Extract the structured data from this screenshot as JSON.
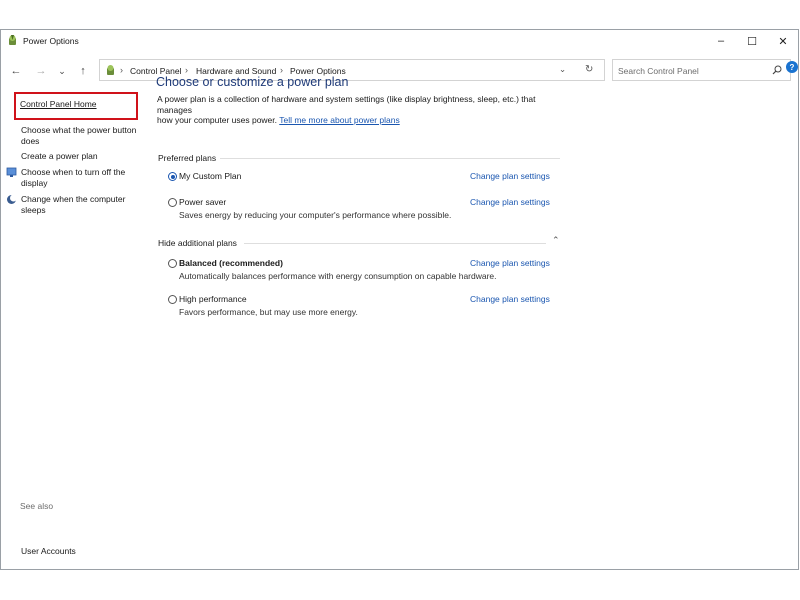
{
  "window": {
    "title": "Power Options",
    "controls": {
      "minimize": "–",
      "maximize": "☐",
      "close": "✕"
    }
  },
  "nav": {
    "back": "←",
    "forward": "→",
    "recent": "⌄",
    "up": "↑"
  },
  "address": {
    "crumbs": [
      "Control Panel",
      "Hardware and Sound",
      "Power Options"
    ],
    "separator": "›",
    "dropdown": "⌄",
    "refresh": "↻"
  },
  "search": {
    "placeholder": "Search Control Panel"
  },
  "help": {
    "label": "?"
  },
  "sidebar": {
    "home": "Control Panel Home",
    "items": [
      {
        "label_line1": "Choose what the power button",
        "label_line2": "does"
      },
      {
        "label_line1": "Create a power plan"
      },
      {
        "label_line1": "Choose when to turn off the",
        "label_line2": "display"
      },
      {
        "label_line1": "Change when the computer",
        "label_line2": "sleeps"
      }
    ],
    "see_also": "See also",
    "user_accounts": "User Accounts"
  },
  "main": {
    "title": "Choose or customize a power plan",
    "desc_line1": "A power plan is a collection of hardware and system settings (like display brightness, sleep, etc.) that manages",
    "desc_line2": "how your computer uses power.",
    "desc_link": "Tell me more about power plans",
    "preferred_heading": "Preferred plans",
    "additional_heading": "Hide additional plans",
    "collapse": "⌃",
    "change_label": "Change plan settings",
    "plans": [
      {
        "name": "My Custom Plan",
        "desc": "",
        "selected": true
      },
      {
        "name": "Power saver",
        "desc": "Saves energy by reducing your computer's performance where possible.",
        "selected": false
      },
      {
        "name": "Balanced (recommended)",
        "desc": "Automatically balances performance with energy consumption on capable hardware.",
        "selected": false
      },
      {
        "name": "High performance",
        "desc": "Favors performance, but may use more energy.",
        "selected": false
      }
    ]
  },
  "colors": {
    "accent": "#1a56b0",
    "title": "#1e3a78",
    "highlight": "#d0121a"
  }
}
